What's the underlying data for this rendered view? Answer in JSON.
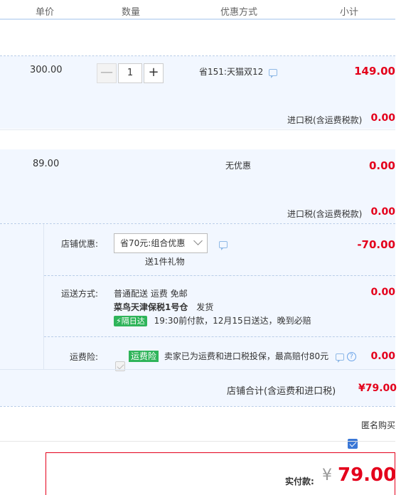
{
  "columns": {
    "unit_price": "单价",
    "quantity": "数量",
    "discount": "优惠方式",
    "subtotal": "小计"
  },
  "item1": {
    "unit_price": "300.00",
    "qty": "1",
    "minus": "—",
    "plus": "+",
    "discount": "省151:天猫双12",
    "subtotal": "149.00",
    "tax_label": "进口税(含运费税款)",
    "tax_value": "0.00"
  },
  "item2": {
    "unit_price": "89.00",
    "discount": "无优惠",
    "subtotal": "0.00",
    "tax_label": "进口税(含运费税款)",
    "tax_value": "0.00"
  },
  "store": {
    "promo_label": "店铺优惠:",
    "promo_selected": "省70元:组合优惠",
    "promo_gift": "送1件礼物",
    "promo_value": "-70.00",
    "shipping_label": "运送方式:",
    "shipping_method": "普通配送 运费 免邮",
    "warehouse": "菜鸟天津保税1号仓",
    "ship_status": "发货",
    "next_day_badge": "隔日达",
    "delivery_note": "19:30前付款，12月15日送达，晚到必赔",
    "shipping_value": "0.00",
    "insurance_label": "运费险:",
    "insurance_tag": "运费险",
    "insurance_text": "卖家已为运费和进口税投保，最高赔付80元",
    "insurance_help": "?",
    "insurance_value": "0.00",
    "total_label": "店铺合计(含运费和进口税)",
    "total_value": "¥79.00"
  },
  "anonymous_purchase": "匿名购买",
  "payment": {
    "label": "实付款:",
    "currency": "¥",
    "amount": "79.00"
  },
  "colors": {
    "accent_red": "#e4001b",
    "row_blue": "#f2f7ff",
    "check_blue": "#3a77d6",
    "tag_green": "#2fb45a"
  }
}
